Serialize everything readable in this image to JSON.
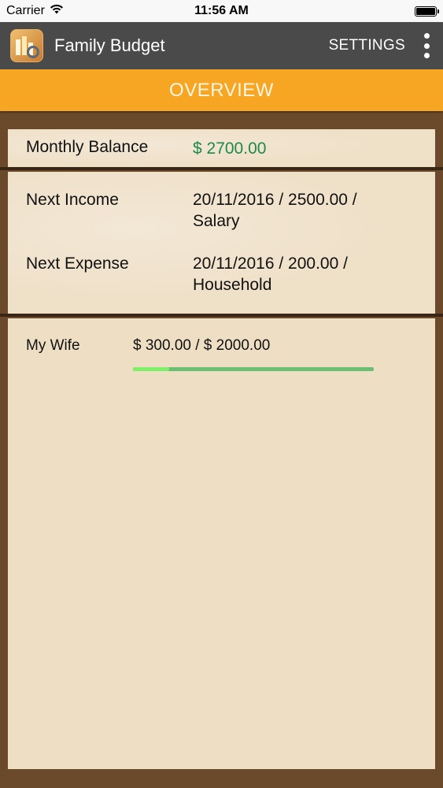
{
  "status_bar": {
    "carrier": "Carrier",
    "time": "11:56 AM",
    "wifi_icon": "wifi-icon",
    "battery_icon": "battery-icon"
  },
  "app_bar": {
    "title": "Family Budget",
    "settings_label": "SETTINGS",
    "app_icon": "family-budget-app-icon",
    "overflow_icon": "more-vert-icon"
  },
  "tab": {
    "label": "OVERVIEW"
  },
  "overview": {
    "monthly_balance_label": "Monthly Balance",
    "monthly_balance_value": "$ 2700.00",
    "next_income_label": "Next Income",
    "next_income_value": "20/11/2016 / 2500.00 / Salary",
    "next_expense_label": "Next Expense",
    "next_expense_value": "20/11/2016 / 200.00 / Household"
  },
  "budgets": [
    {
      "name": "My Wife",
      "amount": "$ 300.00 / $ 2000.00",
      "progress_fraction": 0.15
    }
  ],
  "colors": {
    "accent": "#f6a623",
    "app_bar": "#4a4a4a",
    "positive": "#1e8a4a",
    "progress_fill": "#7ef06a",
    "progress_track": "#6abf72"
  }
}
